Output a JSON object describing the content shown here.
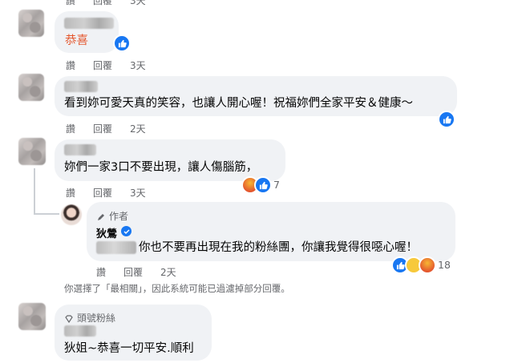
{
  "comments": [
    {
      "text": "恭喜",
      "actions": {
        "like": "讚",
        "reply": "回覆",
        "time": "3天"
      },
      "text_color": "#e4572e"
    },
    {
      "text": "看到妳可愛天真的笑容，也讓人開心喔！祝福妳們全家平安＆健康～",
      "actions": {
        "like": "讚",
        "reply": "回覆",
        "time": "2天"
      }
    },
    {
      "text": "妳們一家3口不要出現，讓人傷腦筋，",
      "actions": {
        "like": "讚",
        "reply": "回覆",
        "time": "3天"
      },
      "reaction_count": "7"
    },
    {
      "tag": "作者",
      "name": "狄鶯",
      "text": "你也不要再出現在我的粉絲團，你讓我覺得很噁心喔！",
      "actions": {
        "like": "讚",
        "reply": "回覆",
        "time": "2天"
      },
      "reaction_count": "18"
    },
    {
      "tag": "頭號粉絲",
      "text": "狄姐~恭喜一切平安.順利"
    }
  ],
  "top_actions": {
    "like": "讚",
    "reply": "回覆",
    "time": "3天"
  },
  "filter_notice": "你選擇了「最相關」，因此系統可能已過濾掉部分回覆。",
  "colors": {
    "like_blue": "#1877f2",
    "bubble": "#f0f2f5",
    "meta": "#65676b"
  }
}
